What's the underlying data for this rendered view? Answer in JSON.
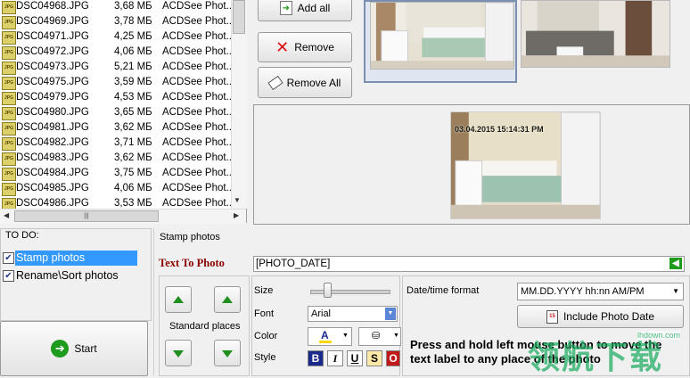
{
  "files": [
    {
      "name": "DSC04968.JPG",
      "size": "3,68 МБ",
      "type": "ACDSee Phot..."
    },
    {
      "name": "DSC04969.JPG",
      "size": "3,78 МБ",
      "type": "ACDSee Phot..."
    },
    {
      "name": "DSC04971.JPG",
      "size": "4,25 МБ",
      "type": "ACDSee Phot..."
    },
    {
      "name": "DSC04972.JPG",
      "size": "4,06 МБ",
      "type": "ACDSee Phot..."
    },
    {
      "name": "DSC04973.JPG",
      "size": "5,21 МБ",
      "type": "ACDSee Phot..."
    },
    {
      "name": "DSC04975.JPG",
      "size": "3,59 МБ",
      "type": "ACDSee Phot..."
    },
    {
      "name": "DSC04979.JPG",
      "size": "4,53 МБ",
      "type": "ACDSee Phot..."
    },
    {
      "name": "DSC04980.JPG",
      "size": "3,65 МБ",
      "type": "ACDSee Phot..."
    },
    {
      "name": "DSC04981.JPG",
      "size": "3,62 МБ",
      "type": "ACDSee Phot..."
    },
    {
      "name": "DSC04982.JPG",
      "size": "3,71 МБ",
      "type": "ACDSee Phot..."
    },
    {
      "name": "DSC04983.JPG",
      "size": "3,62 МБ",
      "type": "ACDSee Phot..."
    },
    {
      "name": "DSC04984.JPG",
      "size": "3,75 МБ",
      "type": "ACDSee Phot..."
    },
    {
      "name": "DSC04985.JPG",
      "size": "4,06 МБ",
      "type": "ACDSee Phot..."
    },
    {
      "name": "DSC04986.JPG",
      "size": "3,53 МБ",
      "type": "ACDSee Phot..."
    }
  ],
  "file_icon_label": "JPG",
  "buttons": {
    "add_all": "Add all",
    "remove": "Remove",
    "remove_all": "Remove All",
    "start": "Start",
    "include_date": "Include Photo Date"
  },
  "preview_stamp": "03.04.2015 15:14:31 PM",
  "todo": {
    "title": "TO DO:",
    "items": [
      {
        "label": "Stamp photos",
        "checked": true
      },
      {
        "label": "Rename\\Sort photos",
        "checked": true
      }
    ]
  },
  "stamp": {
    "section_title": "Stamp photos",
    "text_label": "Text To Photo",
    "text_value": "[PHOTO_DATE]",
    "standard_places": "Standard places",
    "size_label": "Size",
    "size_level": 0.22,
    "font_label": "Font",
    "font_value": "Arial",
    "color_label": "Color",
    "style_label": "Style",
    "style_buttons": [
      "B",
      "I",
      "U",
      "S",
      "O"
    ],
    "datetime_label": "Date/time format",
    "datetime_value": "MM.DD.YYYY hh:nn  AM/PM",
    "hint": "Press and hold left mouse button to move the text label to any place of the photo"
  },
  "watermark": {
    "brand": "领航下载",
    "url": "lhdown.com"
  },
  "colors": {
    "todo_selected": "#3399ff",
    "text_label": "#8b0000",
    "start_arrow": "#1c9b1c",
    "hint": "#000000"
  }
}
